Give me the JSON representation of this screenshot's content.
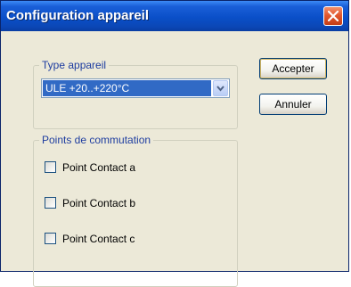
{
  "window": {
    "title": "Configuration appareil"
  },
  "type_group": {
    "legend": "Type appareil",
    "select_value": "ULE +20..+220°C"
  },
  "points_group": {
    "legend": "Points de commutation",
    "items": [
      {
        "label": "Point Contact a",
        "checked": false
      },
      {
        "label": "Point Contact b",
        "checked": false
      },
      {
        "label": "Point Contact c",
        "checked": false
      }
    ]
  },
  "buttons": {
    "accept": "Accepter",
    "cancel": "Annuler"
  },
  "icons": {
    "close": "close-icon",
    "dropdown": "chevron-down-icon"
  },
  "colors": {
    "title_bar": "#0a4fc8",
    "close_button": "#e2582e",
    "dialog_bg": "#ece9d8",
    "group_label": "#1e3da0",
    "selection": "#316ac5"
  }
}
